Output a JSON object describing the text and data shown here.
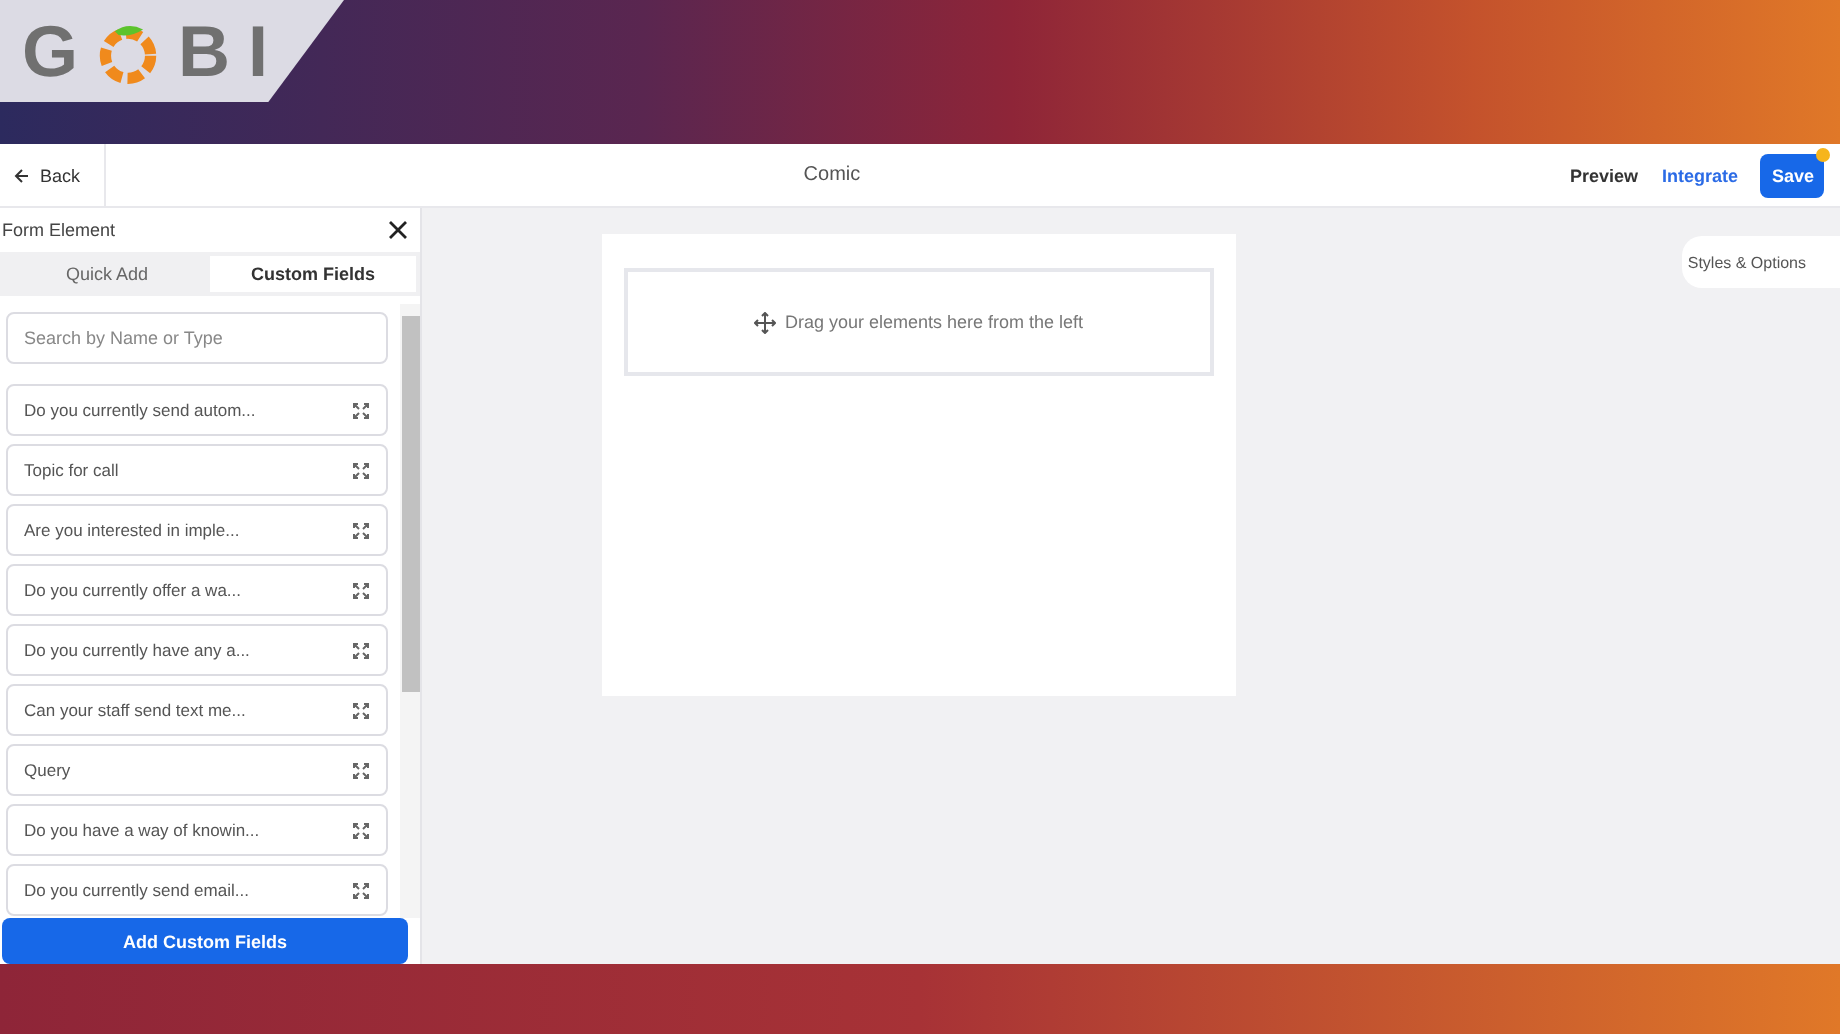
{
  "logo": {
    "letters": [
      "G",
      "B",
      "I"
    ]
  },
  "header": {
    "back": "Back",
    "title": "Comic",
    "preview": "Preview",
    "integrate": "Integrate",
    "save": "Save"
  },
  "panel": {
    "title": "Form Element",
    "tabs": [
      {
        "label": "Quick Add",
        "selected": false
      },
      {
        "label": "Custom Fields",
        "selected": true
      }
    ],
    "search": {
      "placeholder": "Search by Name or Type"
    },
    "fields": [
      "Do you currently send autom...",
      "Topic for call",
      "Are you interested in imple...",
      "Do you currently offer a wa...",
      "Do you currently have any a...",
      "Can your staff send text me...",
      "Query",
      "Do you have a way of knowin...",
      "Do you currently send email..."
    ],
    "add_button": "Add Custom Fields"
  },
  "canvas": {
    "dropzone": "Drag your elements here from the left",
    "styles_tab": "Styles & Options"
  }
}
